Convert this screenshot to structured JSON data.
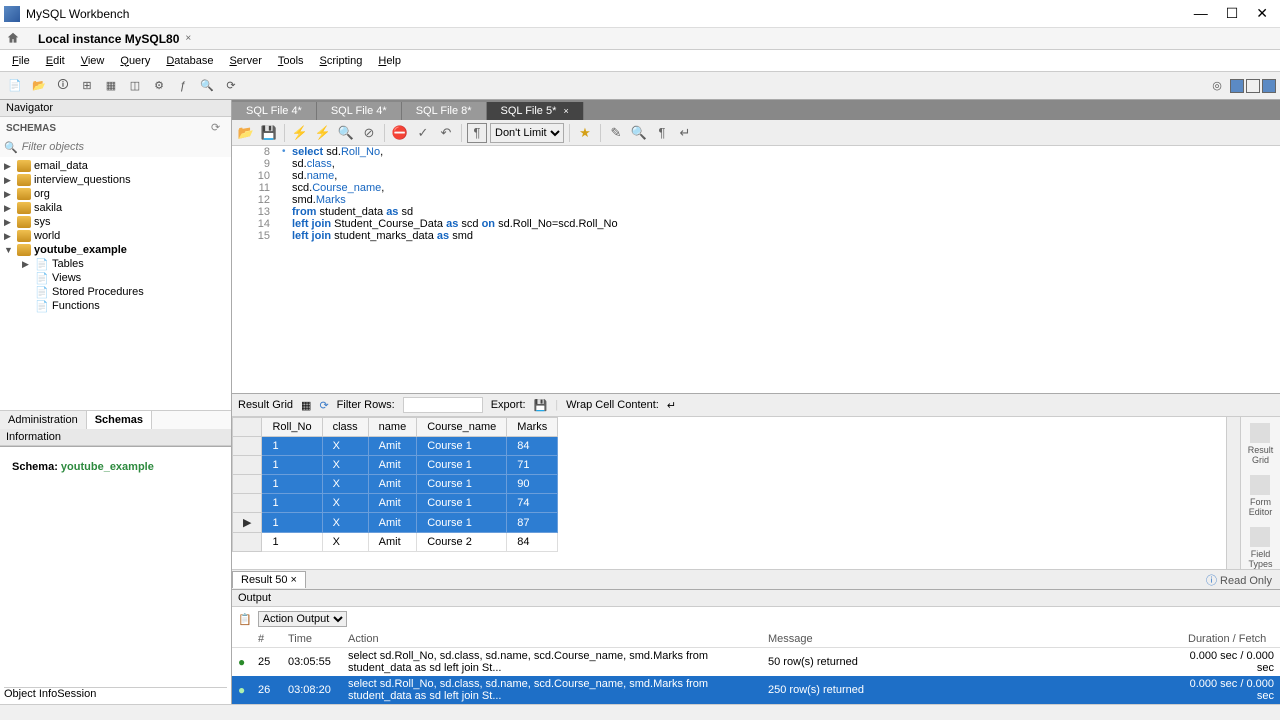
{
  "app_title": "MySQL Workbench",
  "connection_tab": "Local instance MySQL80",
  "menu": [
    "File",
    "Edit",
    "View",
    "Query",
    "Database",
    "Server",
    "Tools",
    "Scripting",
    "Help"
  ],
  "navigator": {
    "title": "Navigator",
    "section": "SCHEMAS",
    "filter_placeholder": "Filter objects",
    "schemas": [
      "email_data",
      "interview_questions",
      "org",
      "sakila",
      "sys",
      "world",
      "youtube_example"
    ],
    "expanded_children": [
      "Tables",
      "Views",
      "Stored Procedures",
      "Functions"
    ],
    "bottom_tabs": [
      "Administration",
      "Schemas"
    ],
    "info_title": "Information",
    "schema_label": "Schema:",
    "schema_value": "youtube_example",
    "info_tabs": [
      "Object Info",
      "Session"
    ]
  },
  "file_tabs": [
    "SQL File 4*",
    "SQL File 4*",
    "SQL File 8*",
    "SQL File 5*"
  ],
  "active_file_tab": 3,
  "limit_option": "Don't Limit",
  "code_lines": [
    {
      "n": 8,
      "dot": true,
      "html": "<span class='kw'>select</span> sd.<span class='fld'>Roll_No</span>,"
    },
    {
      "n": 9,
      "html": "sd.<span class='fld'>class</span>,"
    },
    {
      "n": 10,
      "html": "sd.<span class='fld'>name</span>,"
    },
    {
      "n": 11,
      "html": "scd.<span class='fld'>Course_name</span>,"
    },
    {
      "n": 12,
      "html": "smd.<span class='fld'>Marks</span>"
    },
    {
      "n": 13,
      "html": "<span class='kw'>from</span> student_data <span class='kw'>as</span> sd"
    },
    {
      "n": 14,
      "html": "<span class='kw'>left join</span> Student_Course_Data <span class='kw'>as</span> scd <span class='kw'>on</span> sd.Roll_No=scd.Roll_No"
    },
    {
      "n": 15,
      "html": "<span class='kw'>left join</span> student_marks_data <span class='kw'>as</span> smd"
    }
  ],
  "result_toolbar": {
    "label": "Result Grid",
    "filter": "Filter Rows:",
    "export": "Export:",
    "wrap": "Wrap Cell Content:"
  },
  "result": {
    "columns": [
      "Roll_No",
      "class",
      "name",
      "Course_name",
      "Marks"
    ],
    "rows": [
      {
        "sel": true,
        "cells": [
          "1",
          "X",
          "Amit",
          "Course 1",
          "84"
        ]
      },
      {
        "sel": true,
        "cells": [
          "1",
          "X",
          "Amit",
          "Course 1",
          "71"
        ]
      },
      {
        "sel": true,
        "cells": [
          "1",
          "X",
          "Amit",
          "Course 1",
          "90"
        ]
      },
      {
        "sel": true,
        "cells": [
          "1",
          "X",
          "Amit",
          "Course 1",
          "74"
        ]
      },
      {
        "sel": true,
        "arrow": true,
        "cells": [
          "1",
          "X",
          "Amit",
          "Course 1",
          "87"
        ]
      },
      {
        "sel": false,
        "cells": [
          "1",
          "X",
          "Amit",
          "Course 2",
          "84"
        ]
      }
    ],
    "tab_label": "Result 50",
    "readonly": "Read Only"
  },
  "side_panel": [
    {
      "label": "Result\nGrid"
    },
    {
      "label": "Form\nEditor"
    },
    {
      "label": "Field\nTypes"
    }
  ],
  "output": {
    "title": "Output",
    "dropdown": "Action Output",
    "columns": [
      "",
      "#",
      "Time",
      "Action",
      "Message",
      "Duration / Fetch"
    ],
    "rows": [
      {
        "sel": false,
        "num": "25",
        "time": "03:05:55",
        "action": "select sd.Roll_No, sd.class, sd.name, scd.Course_name, smd.Marks from student_data as sd left join St...",
        "msg": "50 row(s) returned",
        "dur": "0.000 sec / 0.000 sec"
      },
      {
        "sel": true,
        "num": "26",
        "time": "03:08:20",
        "action": "select sd.Roll_No, sd.class, sd.name, scd.Course_name, smd.Marks from student_data as sd left join St...",
        "msg": "250 row(s) returned",
        "dur": "0.000 sec / 0.000 sec"
      }
    ]
  }
}
